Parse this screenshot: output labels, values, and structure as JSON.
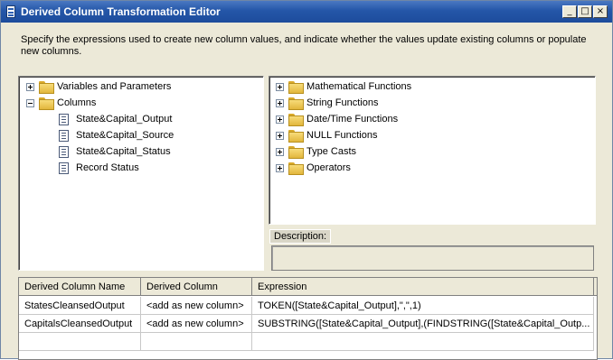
{
  "window": {
    "title": "Derived Column Transformation Editor"
  },
  "title_buttons": {
    "minimize": "_",
    "maximize": "□",
    "close": "×"
  },
  "intro": "Specify the expressions used to create new column values, and indicate whether the values update existing columns or populate new columns.",
  "left_tree": {
    "variables": "Variables and Parameters",
    "columns": "Columns",
    "column_items": [
      "State&Capital_Output",
      "State&Capital_Source",
      "State&Capital_Status",
      "Record Status"
    ]
  },
  "right_tree": {
    "items": [
      "Mathematical Functions",
      "String Functions",
      "Date/Time Functions",
      "NULL Functions",
      "Type Casts",
      "Operators"
    ]
  },
  "description": {
    "label": "Description:"
  },
  "grid": {
    "headers": [
      "Derived Column Name",
      "Derived Column",
      "Expression"
    ],
    "rows": [
      {
        "name": "StatesCleansedOutput",
        "derived": "<add as new column>",
        "expression": "TOKEN([State&Capital_Output],\",\",1)"
      },
      {
        "name": "CapitalsCleansedOutput",
        "derived": "<add as new column>",
        "expression": "SUBSTRING([State&Capital_Output],(FINDSTRING([State&Capital_Outp..."
      }
    ]
  }
}
